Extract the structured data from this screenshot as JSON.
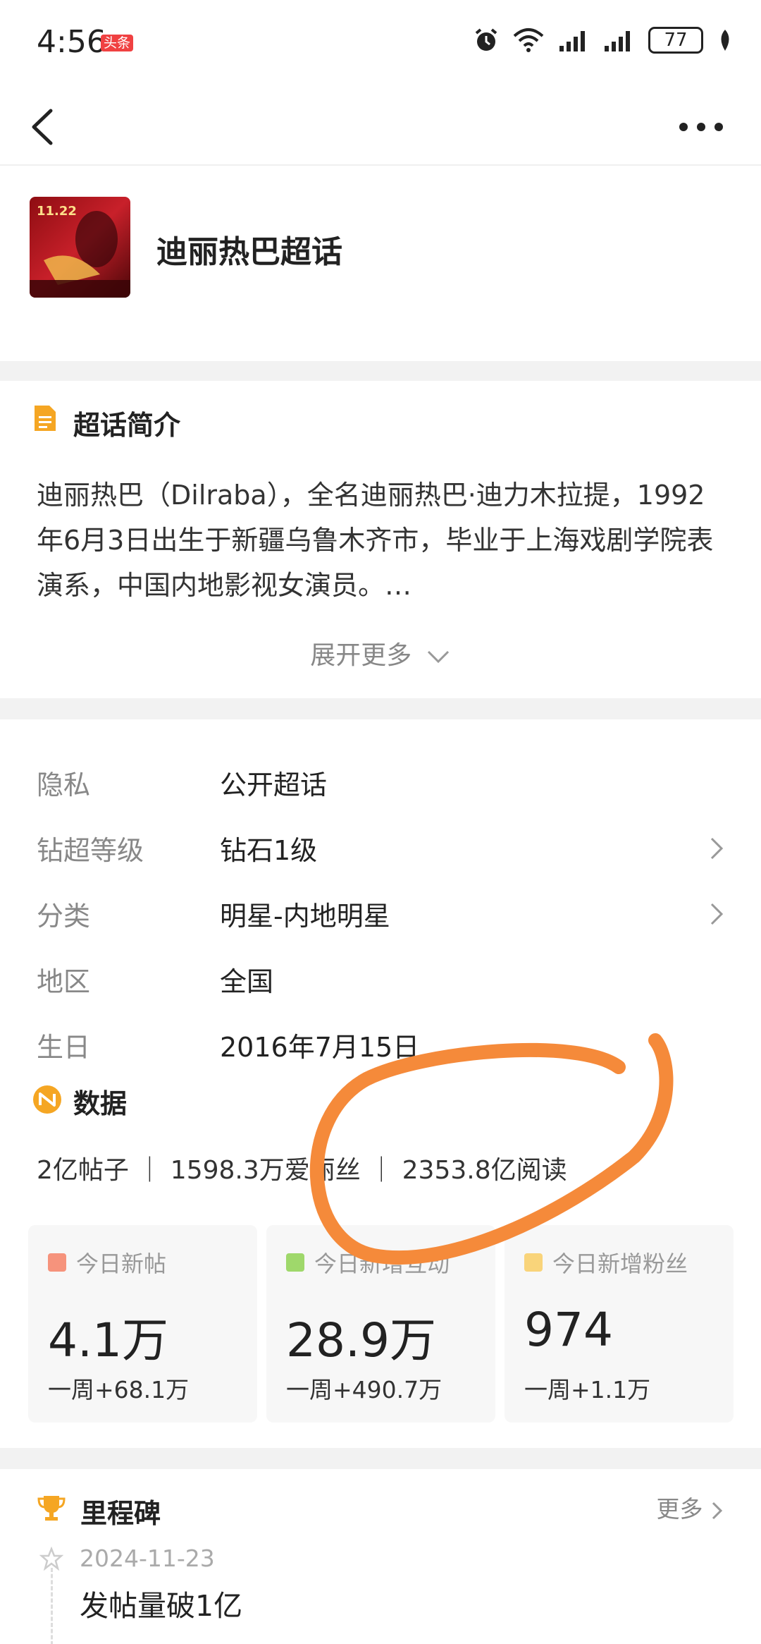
{
  "status_bar": {
    "time": "4:56",
    "badge": "头条",
    "battery": "77"
  },
  "header": {
    "topic_name": "迪丽热巴超话",
    "cover_date": "11.22"
  },
  "intro": {
    "title": "超话简介",
    "text": "迪丽热巴（Dilraba），全名迪丽热巴·迪力木拉提，1992年6月3日出生于新疆乌鲁木齐市，毕业于上海戏剧学院表演系，中国内地影视女演员。…",
    "expand_label": "展开更多"
  },
  "info": {
    "rows": [
      {
        "label": "隐私",
        "value": "公开超话"
      },
      {
        "label": "钻超等级",
        "value": "钻石1级"
      },
      {
        "label": "分类",
        "value": "明星-内地明星"
      },
      {
        "label": "地区",
        "value": "全国"
      },
      {
        "label": "生日",
        "value": "2016年7月15日"
      }
    ]
  },
  "data": {
    "title": "数据",
    "summary": "2亿帖子 ｜ 1598.3万爱丽丝 ｜ 2353.8亿阅读",
    "cards": [
      {
        "label": "今日新帖",
        "value": "4.1万",
        "sub": "一周+68.1万",
        "color": "#f6937c"
      },
      {
        "label": "今日新增互动",
        "value": "28.9万",
        "sub": "一周+490.7万",
        "color": "#9fd86b"
      },
      {
        "label": "今日新增粉丝",
        "value": "974",
        "sub": "一周+1.1万",
        "color": "#f9d47a"
      }
    ]
  },
  "milestone": {
    "title": "里程碑",
    "more_label": "更多",
    "items": [
      {
        "date": "2024-11-23",
        "text": "发帖量破1亿"
      }
    ]
  },
  "colors": {
    "accent": "#f5a623",
    "annotation": "#f58a3a"
  }
}
